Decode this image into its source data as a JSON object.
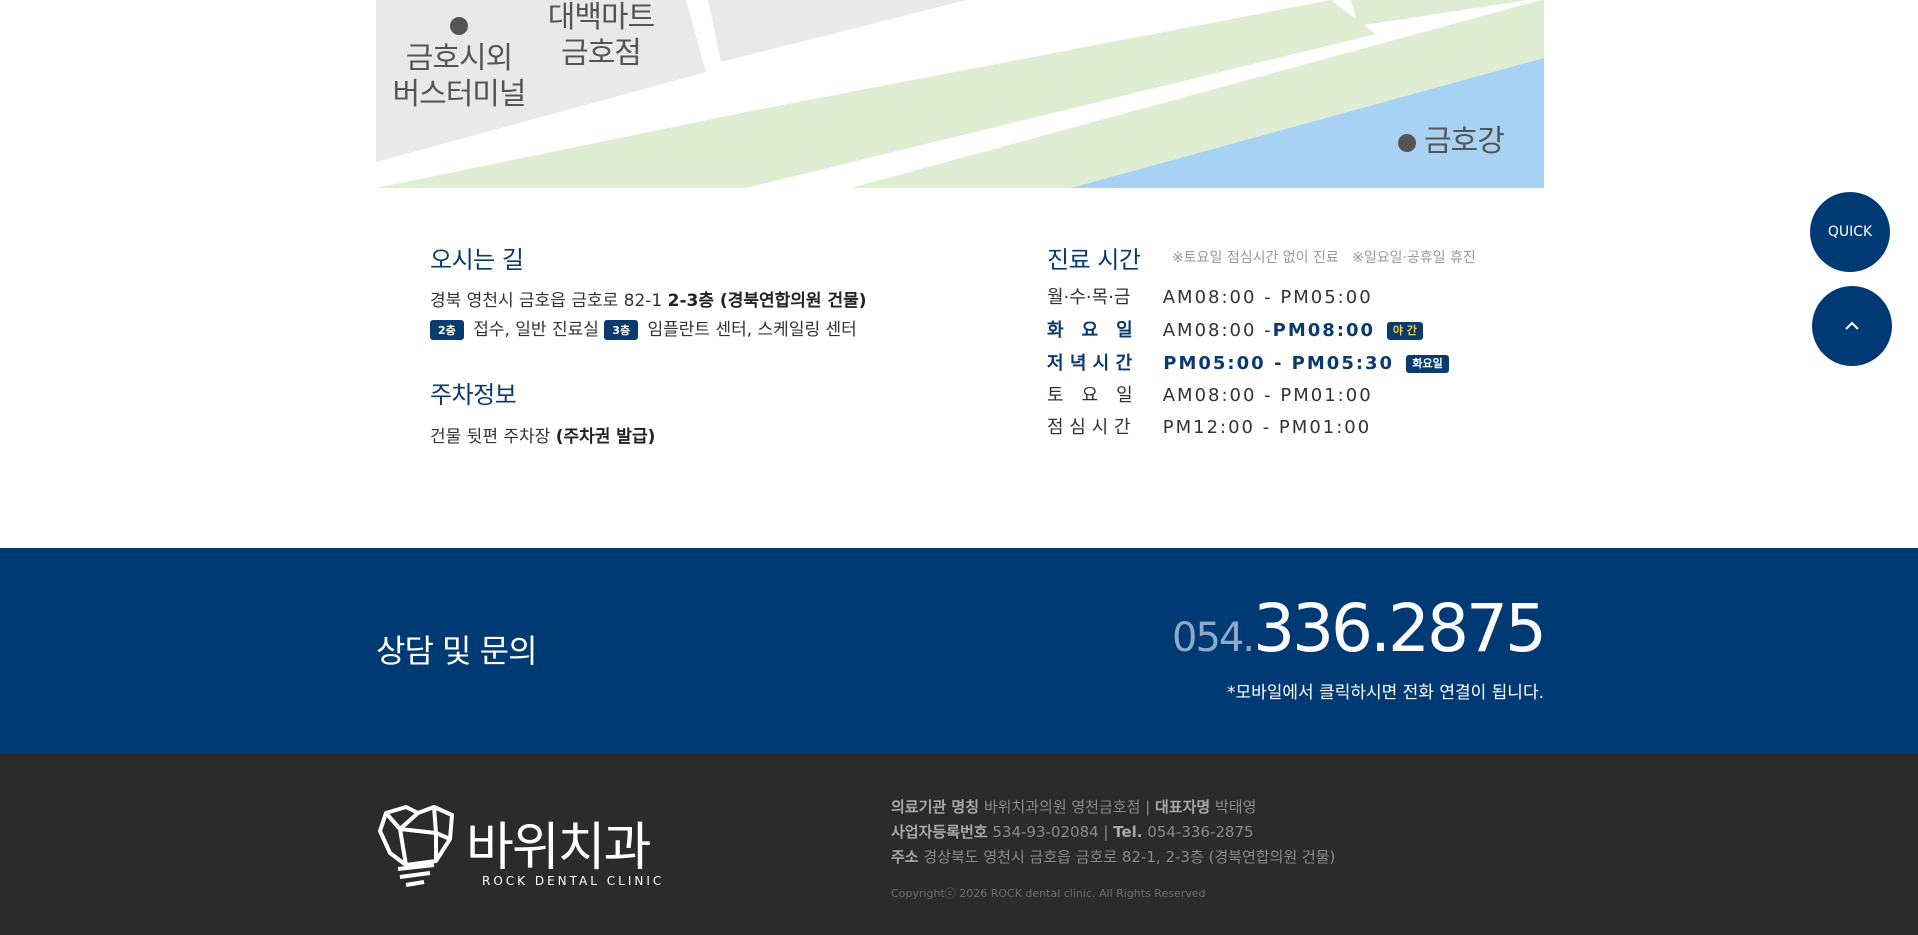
{
  "map": {
    "labels": {
      "bus_terminal": "금호시외\n버스터미널",
      "mart": "대백마트\n금호점",
      "river": "금호강"
    }
  },
  "directions": {
    "title": "오시는 길",
    "address_plain": "경북 영천시 금호읍 금호로 82-1",
    "address_bold": "2-3층 (경북연합의원 건물)",
    "floor2_badge": "2층",
    "floor2_text": "접수, 일반 진료실",
    "floor3_badge": "3층",
    "floor3_text": "임플란트 센터, 스케일링 센터"
  },
  "parking": {
    "title": "주차정보",
    "text_plain": "건물 뒷편 주차장",
    "text_bold": "(주차권 발급)"
  },
  "hours": {
    "title": "진료 시간",
    "note": "※토요일 점심시간 없이 진료   ※일요일·공휴일 휴진",
    "rows": [
      {
        "day": "월·수·목·금",
        "time": "AM08:00 - PM05:00"
      },
      {
        "day": "화　요　일",
        "time_a": "AM08:00 - ",
        "time_b": "PM08:00",
        "tag": "야 간"
      },
      {
        "day": "저 녁 시 간",
        "time": "PM05:00 - PM05:30",
        "tag": "화요일"
      },
      {
        "day": "토　요　일",
        "time": "AM08:00 - PM01:00"
      },
      {
        "day": "점 심 시 간",
        "time": "PM12:00 - PM01:00"
      }
    ]
  },
  "contact": {
    "title": "상담 및 문의",
    "phone_prefix": "054.",
    "phone_main": "336.2875",
    "note": "*모바일에서 클릭하시면 전화 연결이 됩니다."
  },
  "footer": {
    "logo_name": "바위치과",
    "logo_sub": "ROCK DENTAL CLINIC",
    "l1_label1": "의료기관 명칭",
    "l1_value1": "바위치과의원 영천금호점",
    "l1_label2": "대표자명",
    "l1_value2": "박태영",
    "l2_label1": "사업자등록번호",
    "l2_value1": "534-93-02084",
    "l2_label2": "Tel.",
    "l2_value2": "054-336-2875",
    "l3_label": "주소",
    "l3_value": "경상북도 영천시 금호읍 금호로 82-1, 2-3층 (경북연합의원 건물)",
    "copyright": "Copyrightⓒ 2026 ROCK dental clinic. All Rights Reserved"
  },
  "quick": {
    "label": "QUICK",
    "top_icon": "chevron-up-icon"
  },
  "colors": {
    "brand": "#003a74",
    "footer_bg": "#2b2b2b",
    "map_green": "#dfedd2",
    "map_river": "#a7d2f3",
    "map_block": "#e9e9e9"
  }
}
